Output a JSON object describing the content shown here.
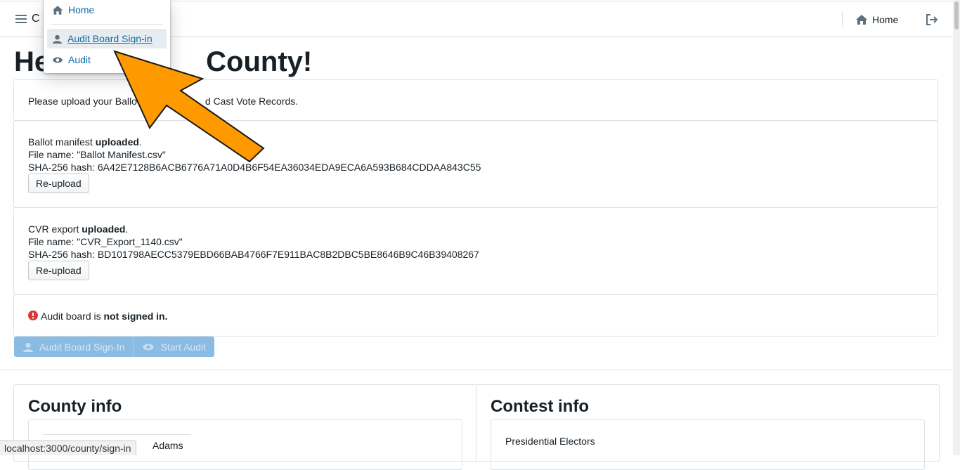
{
  "navbar": {
    "brand": "C",
    "home_label": "Home"
  },
  "menu": {
    "items": [
      {
        "label": "Home"
      },
      {
        "label": "Audit Board Sign-in"
      },
      {
        "label": "Audit"
      }
    ]
  },
  "page": {
    "heading_left": "He",
    "heading_right": "County!"
  },
  "upload_intro": {
    "text_start": "Please upload your Ballo",
    "text_end": "d Cast Vote Records."
  },
  "ballot_manifest": {
    "prefix": "Ballot manifest",
    "status": "uploaded",
    "file_name": "File name: \"Ballot Manifest.csv\"",
    "hash": "SHA-256 hash: 6A42E7128B6ACB6776A71A0D4B6F54EA36034EDA9ECA6A593B684CDDAA843C55",
    "button": "Re-upload"
  },
  "cvr_export": {
    "prefix": "CVR export",
    "status": "uploaded",
    "file_name": "File name: \"CVR_Export_1140.csv\"",
    "hash": "SHA-256 hash: BD101798AECC5379EBD66BAB4766F7E911BAC8B2DBC5BE8646B9C46B39408267",
    "button": "Re-upload"
  },
  "audit_board": {
    "prefix": "Audit board is",
    "status": "not signed in."
  },
  "actions": {
    "sign_in": "Audit Board Sign-In",
    "start_audit": "Start Audit"
  },
  "county_info": {
    "title": "County info",
    "partial_text": "Adams"
  },
  "contest_info": {
    "title": "Contest info",
    "first_contest": "Presidential Electors"
  },
  "status_bar": {
    "url": "localhost:3000/county/sign-in"
  },
  "colors": {
    "link": "#106ba3",
    "primary_disabled": "#8abbe3",
    "warning": "#db3737",
    "arrow": "#ff9900"
  }
}
